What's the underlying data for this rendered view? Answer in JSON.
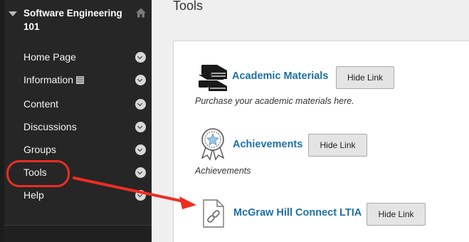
{
  "course": {
    "title": "Software Engineering 101"
  },
  "nav": {
    "items": [
      {
        "label": "Home Page"
      },
      {
        "label": "Information"
      },
      {
        "label": "Content"
      },
      {
        "label": "Discussions"
      },
      {
        "label": "Groups"
      },
      {
        "label": "Tools"
      },
      {
        "label": "Help"
      }
    ]
  },
  "page": {
    "title": "Tools"
  },
  "tools": [
    {
      "name": "Academic Materials",
      "button": "Hide Link",
      "description": "Purchase your academic materials here.",
      "icon": "books-icon"
    },
    {
      "name": "Achievements",
      "button": "Hide Link",
      "description": "Achievements",
      "icon": "award-ribbon-icon"
    },
    {
      "name": "McGraw Hill Connect LTIA",
      "button": "Hide Link",
      "icon": "link-document-icon"
    }
  ],
  "colors": {
    "sidebar": "#262626",
    "link": "#1d6fa5",
    "annotation": "#ee2d22"
  }
}
